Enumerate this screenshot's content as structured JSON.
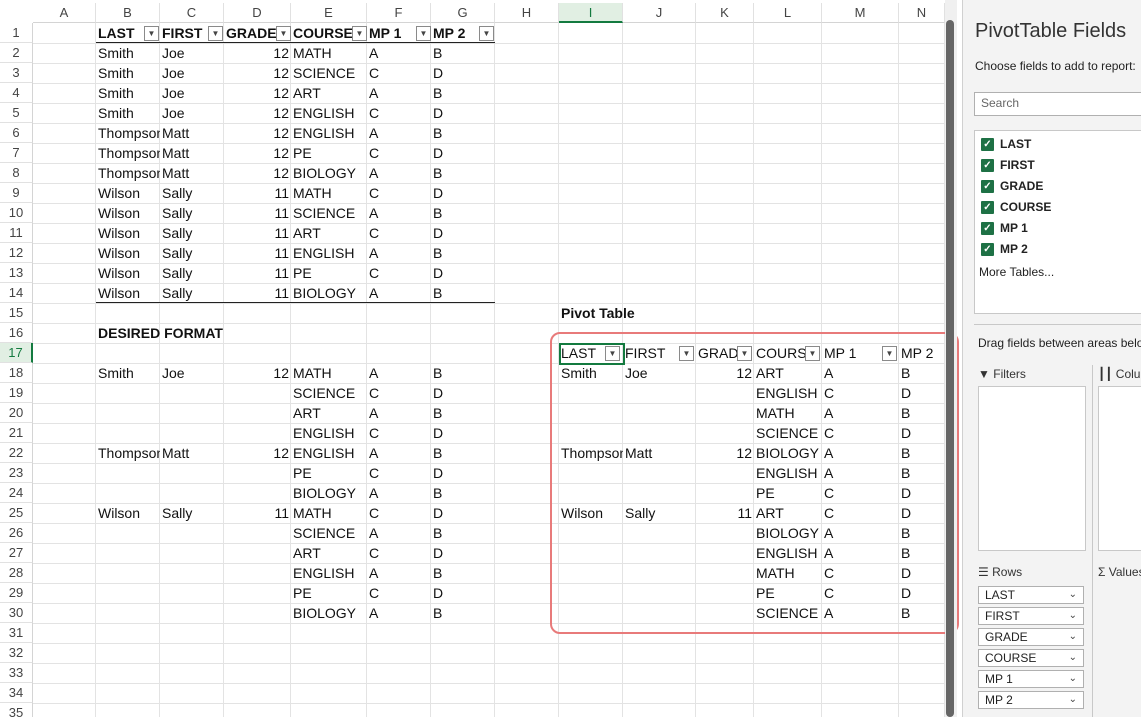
{
  "columns": [
    "A",
    "B",
    "C",
    "D",
    "E",
    "F",
    "G",
    "H",
    "I",
    "J",
    "K",
    "L",
    "M",
    "N"
  ],
  "rows": [
    "1",
    "2",
    "3",
    "4",
    "5",
    "6",
    "7",
    "8",
    "9",
    "10",
    "11",
    "12",
    "13",
    "14",
    "15",
    "16",
    "17",
    "18",
    "19",
    "20",
    "21",
    "22",
    "23",
    "24",
    "25",
    "26",
    "27",
    "28",
    "29",
    "30",
    "31",
    "32",
    "33",
    "34",
    "35"
  ],
  "selected_column": "I",
  "selected_row": "17",
  "source_table": {
    "headers": [
      "LAST",
      "FIRST",
      "GRADE",
      "COURSE",
      "MP 1",
      "MP 2"
    ],
    "rows": [
      [
        "Smith",
        "Joe",
        "12",
        "MATH",
        "A",
        "B"
      ],
      [
        "Smith",
        "Joe",
        "12",
        "SCIENCE",
        "C",
        "D"
      ],
      [
        "Smith",
        "Joe",
        "12",
        "ART",
        "A",
        "B"
      ],
      [
        "Smith",
        "Joe",
        "12",
        "ENGLISH",
        "C",
        "D"
      ],
      [
        "Thompson",
        "Matt",
        "12",
        "ENGLISH",
        "A",
        "B"
      ],
      [
        "Thompson",
        "Matt",
        "12",
        "PE",
        "C",
        "D"
      ],
      [
        "Thompson",
        "Matt",
        "12",
        "BIOLOGY",
        "A",
        "B"
      ],
      [
        "Wilson",
        "Sally",
        "11",
        "MATH",
        "C",
        "D"
      ],
      [
        "Wilson",
        "Sally",
        "11",
        "SCIENCE",
        "A",
        "B"
      ],
      [
        "Wilson",
        "Sally",
        "11",
        "ART",
        "C",
        "D"
      ],
      [
        "Wilson",
        "Sally",
        "11",
        "ENGLISH",
        "A",
        "B"
      ],
      [
        "Wilson",
        "Sally",
        "11",
        "PE",
        "C",
        "D"
      ],
      [
        "Wilson",
        "Sally",
        "11",
        "BIOLOGY",
        "A",
        "B"
      ]
    ]
  },
  "desired_format": {
    "title": "DESIRED FORMAT",
    "rows": [
      [
        "Smith",
        "Joe",
        "12",
        "MATH",
        "A",
        "B"
      ],
      [
        "",
        "",
        "",
        "SCIENCE",
        "C",
        "D"
      ],
      [
        "",
        "",
        "",
        "ART",
        "A",
        "B"
      ],
      [
        "",
        "",
        "",
        "ENGLISH",
        "C",
        "D"
      ],
      [
        "Thompson",
        "Matt",
        "12",
        "ENGLISH",
        "A",
        "B"
      ],
      [
        "",
        "",
        "",
        "PE",
        "C",
        "D"
      ],
      [
        "",
        "",
        "",
        "BIOLOGY",
        "A",
        "B"
      ],
      [
        "Wilson",
        "Sally",
        "11",
        "MATH",
        "C",
        "D"
      ],
      [
        "",
        "",
        "",
        "SCIENCE",
        "A",
        "B"
      ],
      [
        "",
        "",
        "",
        "ART",
        "C",
        "D"
      ],
      [
        "",
        "",
        "",
        "ENGLISH",
        "A",
        "B"
      ],
      [
        "",
        "",
        "",
        "PE",
        "C",
        "D"
      ],
      [
        "",
        "",
        "",
        "BIOLOGY",
        "A",
        "B"
      ]
    ]
  },
  "pivot_table": {
    "title": "Pivot Table",
    "headers": [
      "LAST",
      "FIRST",
      "GRADE",
      "COURSE",
      "MP 1",
      "MP 2"
    ],
    "rows": [
      [
        "Smith",
        "Joe",
        "12",
        "ART",
        "A",
        "B"
      ],
      [
        "",
        "",
        "",
        "ENGLISH",
        "C",
        "D"
      ],
      [
        "",
        "",
        "",
        "MATH",
        "A",
        "B"
      ],
      [
        "",
        "",
        "",
        "SCIENCE",
        "C",
        "D"
      ],
      [
        "Thompson",
        "Matt",
        "12",
        "BIOLOGY",
        "A",
        "B"
      ],
      [
        "",
        "",
        "",
        "ENGLISH",
        "A",
        "B"
      ],
      [
        "",
        "",
        "",
        "PE",
        "C",
        "D"
      ],
      [
        "Wilson",
        "Sally",
        "11",
        "ART",
        "C",
        "D"
      ],
      [
        "",
        "",
        "",
        "BIOLOGY",
        "A",
        "B"
      ],
      [
        "",
        "",
        "",
        "ENGLISH",
        "A",
        "B"
      ],
      [
        "",
        "",
        "",
        "MATH",
        "C",
        "D"
      ],
      [
        "",
        "",
        "",
        "PE",
        "C",
        "D"
      ],
      [
        "",
        "",
        "",
        "SCIENCE",
        "A",
        "B"
      ]
    ]
  },
  "panel": {
    "title": "PivotTable Fields",
    "subtitle": "Choose fields to add to report:",
    "search_placeholder": "Search",
    "fields": [
      "LAST",
      "FIRST",
      "GRADE",
      "COURSE",
      "MP 1",
      "MP 2"
    ],
    "more_tables": "More Tables...",
    "drag_text": "Drag fields between areas below:",
    "filters_label": "Filters",
    "columns_label": "Columns",
    "rows_label": "Rows",
    "values_label": "Values",
    "row_fields": [
      "LAST",
      "FIRST",
      "GRADE",
      "COURSE",
      "MP 1",
      "MP 2"
    ]
  },
  "colors": {
    "excel_green": "#137a3f",
    "frame": "#e87a7a",
    "checkbox": "#1e7145"
  }
}
